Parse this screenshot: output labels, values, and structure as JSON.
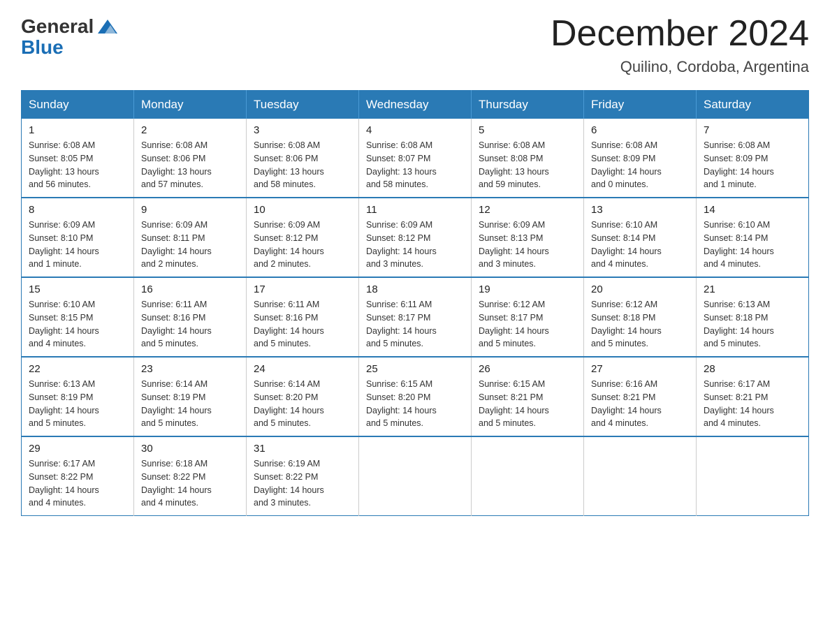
{
  "header": {
    "logo": {
      "general": "General",
      "blue": "Blue"
    },
    "title": "December 2024",
    "location": "Quilino, Cordoba, Argentina"
  },
  "calendar": {
    "weekdays": [
      "Sunday",
      "Monday",
      "Tuesday",
      "Wednesday",
      "Thursday",
      "Friday",
      "Saturday"
    ],
    "weeks": [
      [
        {
          "day": "1",
          "sunrise": "6:08 AM",
          "sunset": "8:05 PM",
          "daylight": "13 hours and 56 minutes."
        },
        {
          "day": "2",
          "sunrise": "6:08 AM",
          "sunset": "8:06 PM",
          "daylight": "13 hours and 57 minutes."
        },
        {
          "day": "3",
          "sunrise": "6:08 AM",
          "sunset": "8:06 PM",
          "daylight": "13 hours and 58 minutes."
        },
        {
          "day": "4",
          "sunrise": "6:08 AM",
          "sunset": "8:07 PM",
          "daylight": "13 hours and 58 minutes."
        },
        {
          "day": "5",
          "sunrise": "6:08 AM",
          "sunset": "8:08 PM",
          "daylight": "13 hours and 59 minutes."
        },
        {
          "day": "6",
          "sunrise": "6:08 AM",
          "sunset": "8:09 PM",
          "daylight": "14 hours and 0 minutes."
        },
        {
          "day": "7",
          "sunrise": "6:08 AM",
          "sunset": "8:09 PM",
          "daylight": "14 hours and 1 minute."
        }
      ],
      [
        {
          "day": "8",
          "sunrise": "6:09 AM",
          "sunset": "8:10 PM",
          "daylight": "14 hours and 1 minute."
        },
        {
          "day": "9",
          "sunrise": "6:09 AM",
          "sunset": "8:11 PM",
          "daylight": "14 hours and 2 minutes."
        },
        {
          "day": "10",
          "sunrise": "6:09 AM",
          "sunset": "8:12 PM",
          "daylight": "14 hours and 2 minutes."
        },
        {
          "day": "11",
          "sunrise": "6:09 AM",
          "sunset": "8:12 PM",
          "daylight": "14 hours and 3 minutes."
        },
        {
          "day": "12",
          "sunrise": "6:09 AM",
          "sunset": "8:13 PM",
          "daylight": "14 hours and 3 minutes."
        },
        {
          "day": "13",
          "sunrise": "6:10 AM",
          "sunset": "8:14 PM",
          "daylight": "14 hours and 4 minutes."
        },
        {
          "day": "14",
          "sunrise": "6:10 AM",
          "sunset": "8:14 PM",
          "daylight": "14 hours and 4 minutes."
        }
      ],
      [
        {
          "day": "15",
          "sunrise": "6:10 AM",
          "sunset": "8:15 PM",
          "daylight": "14 hours and 4 minutes."
        },
        {
          "day": "16",
          "sunrise": "6:11 AM",
          "sunset": "8:16 PM",
          "daylight": "14 hours and 5 minutes."
        },
        {
          "day": "17",
          "sunrise": "6:11 AM",
          "sunset": "8:16 PM",
          "daylight": "14 hours and 5 minutes."
        },
        {
          "day": "18",
          "sunrise": "6:11 AM",
          "sunset": "8:17 PM",
          "daylight": "14 hours and 5 minutes."
        },
        {
          "day": "19",
          "sunrise": "6:12 AM",
          "sunset": "8:17 PM",
          "daylight": "14 hours and 5 minutes."
        },
        {
          "day": "20",
          "sunrise": "6:12 AM",
          "sunset": "8:18 PM",
          "daylight": "14 hours and 5 minutes."
        },
        {
          "day": "21",
          "sunrise": "6:13 AM",
          "sunset": "8:18 PM",
          "daylight": "14 hours and 5 minutes."
        }
      ],
      [
        {
          "day": "22",
          "sunrise": "6:13 AM",
          "sunset": "8:19 PM",
          "daylight": "14 hours and 5 minutes."
        },
        {
          "day": "23",
          "sunrise": "6:14 AM",
          "sunset": "8:19 PM",
          "daylight": "14 hours and 5 minutes."
        },
        {
          "day": "24",
          "sunrise": "6:14 AM",
          "sunset": "8:20 PM",
          "daylight": "14 hours and 5 minutes."
        },
        {
          "day": "25",
          "sunrise": "6:15 AM",
          "sunset": "8:20 PM",
          "daylight": "14 hours and 5 minutes."
        },
        {
          "day": "26",
          "sunrise": "6:15 AM",
          "sunset": "8:21 PM",
          "daylight": "14 hours and 5 minutes."
        },
        {
          "day": "27",
          "sunrise": "6:16 AM",
          "sunset": "8:21 PM",
          "daylight": "14 hours and 4 minutes."
        },
        {
          "day": "28",
          "sunrise": "6:17 AM",
          "sunset": "8:21 PM",
          "daylight": "14 hours and 4 minutes."
        }
      ],
      [
        {
          "day": "29",
          "sunrise": "6:17 AM",
          "sunset": "8:22 PM",
          "daylight": "14 hours and 4 minutes."
        },
        {
          "day": "30",
          "sunrise": "6:18 AM",
          "sunset": "8:22 PM",
          "daylight": "14 hours and 4 minutes."
        },
        {
          "day": "31",
          "sunrise": "6:19 AM",
          "sunset": "8:22 PM",
          "daylight": "14 hours and 3 minutes."
        },
        null,
        null,
        null,
        null
      ]
    ],
    "labels": {
      "sunrise": "Sunrise:",
      "sunset": "Sunset:",
      "daylight": "Daylight:"
    }
  }
}
